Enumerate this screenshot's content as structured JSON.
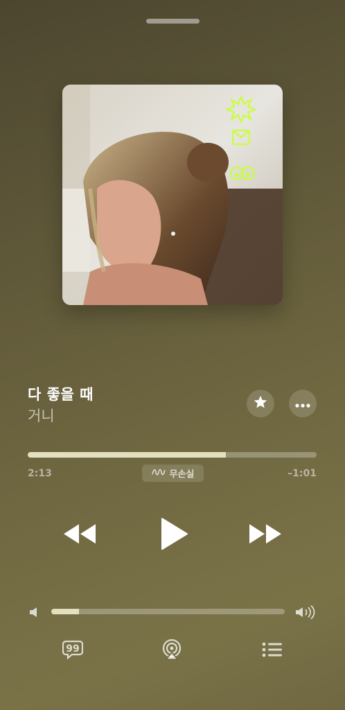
{
  "now_playing": {
    "title": "다 좋을 때",
    "artist": "거니",
    "elapsed": "2:13",
    "remaining": "–1:01",
    "progress_fraction": 0.687,
    "quality_badge": "무손실",
    "artwork_stamps": [
      "✵",
      "🎀",
      "👀"
    ]
  },
  "volume": {
    "level_fraction": 0.12
  },
  "icons": {
    "favorite": "star-icon",
    "more": "ellipsis-icon",
    "quality": "lossless-wave-icon",
    "rewind": "rewind-icon",
    "play": "play-icon",
    "forward": "fast-forward-icon",
    "volume_low": "speaker-low-icon",
    "volume_high": "speaker-high-icon",
    "lyrics": "lyrics-icon",
    "airplay": "airplay-icon",
    "queue": "queue-list-icon"
  },
  "colors": {
    "accent_fill": "#e4dfbf",
    "background_top": "#4c4630",
    "background_bottom": "#7a7247",
    "sticker_neon": "#c8ff3a"
  }
}
